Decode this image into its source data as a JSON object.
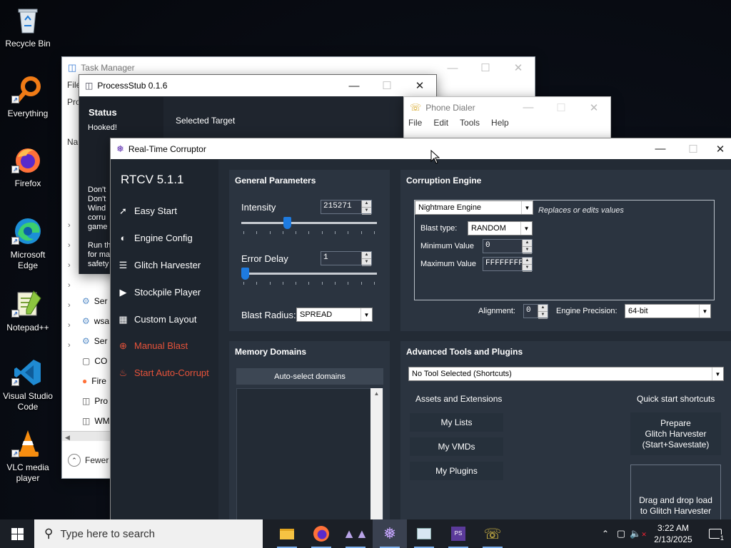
{
  "desktop": {
    "icons": [
      {
        "label": "Recycle Bin",
        "icon": "recycle-bin-icon"
      },
      {
        "label": "Everything",
        "icon": "everything-search-icon"
      },
      {
        "label": "Firefox",
        "icon": "firefox-icon"
      },
      {
        "label": "Microsoft Edge",
        "icon": "edge-icon"
      },
      {
        "label": "Notepad++",
        "icon": "notepadpp-icon"
      },
      {
        "label": "Visual Studio Code",
        "icon": "vscode-icon"
      },
      {
        "label": "VLC media player",
        "icon": "vlc-icon"
      }
    ]
  },
  "task_manager": {
    "title": "Task Manager",
    "menu_file": "File",
    "tab_partial": "Pro",
    "col_partial": "Nam",
    "rows": [
      "Ser",
      "wsa",
      "Ser",
      "CO",
      "Fire",
      "Pro",
      "WM"
    ],
    "fewer": "Fewer"
  },
  "process_stub": {
    "title": "ProcessStub 0.1.6",
    "status_heading": "Status",
    "status_value": "Hooked!",
    "selected_target": "Selected Target",
    "warning_lines": [
      "Don't",
      "Don't",
      "Wind",
      "corru",
      "game"
    ],
    "run_lines": [
      "Run th",
      "for ma",
      "safety"
    ]
  },
  "phone_dialer": {
    "title": "Phone Dialer",
    "menu": [
      "File",
      "Edit",
      "Tools",
      "Help"
    ]
  },
  "rtcv": {
    "title": "Real-Time Corruptor",
    "version": "RTCV 5.1.1",
    "sidebar": [
      {
        "label": "Easy Start",
        "icon": "wand-icon",
        "red": false
      },
      {
        "label": "Engine Config",
        "icon": "gauge-icon",
        "red": false
      },
      {
        "label": "Glitch Harvester",
        "icon": "layers-icon",
        "red": false
      },
      {
        "label": "Stockpile Player",
        "icon": "play-icon",
        "red": false
      },
      {
        "label": "Custom Layout",
        "icon": "grid-icon",
        "red": false
      },
      {
        "label": "Manual Blast",
        "icon": "crosshair-icon",
        "red": true
      },
      {
        "label": "Start Auto-Corrupt",
        "icon": "flame-icon",
        "red": true
      }
    ],
    "general": {
      "heading": "General Parameters",
      "intensity_label": "Intensity",
      "intensity_value": "215271",
      "intensity_level": 0.33,
      "error_delay_label": "Error Delay",
      "error_delay_value": "1",
      "error_delay_level": 0.0,
      "blast_radius_label": "Blast Radius:",
      "blast_radius_value": "SPREAD"
    },
    "engine": {
      "heading": "Corruption Engine",
      "engine_value": "Nightmare Engine",
      "engine_desc": "Replaces or edits values",
      "blast_type_label": "Blast type:",
      "blast_type_value": "RANDOM",
      "min_label": "Minimum Value",
      "min_value": "0",
      "max_label": "Maximum Value",
      "max_value": "FFFFFFFF",
      "alignment_label": "Alignment:",
      "alignment_value": "0",
      "precision_label": "Engine Precision:",
      "precision_value": "64-bit"
    },
    "memory": {
      "heading": "Memory Domains",
      "auto_select": "Auto-select domains"
    },
    "advanced": {
      "heading": "Advanced Tools and Plugins",
      "tool_select": "No Tool Selected (Shortcuts)",
      "assets_heading": "Assets and Extensions",
      "quick_heading": "Quick start shortcuts",
      "buttons": [
        "My Lists",
        "My VMDs",
        "My Plugins"
      ],
      "prepare": "Prepare\nGlitch Harvester\n(Start+Savestate)",
      "drag_drop": "Drag and drop load\nto Glitch Harvester"
    }
  },
  "taskbar": {
    "search_placeholder": "Type here to search",
    "time": "3:22 AM",
    "date": "2/13/2025",
    "notification_count": "1"
  }
}
